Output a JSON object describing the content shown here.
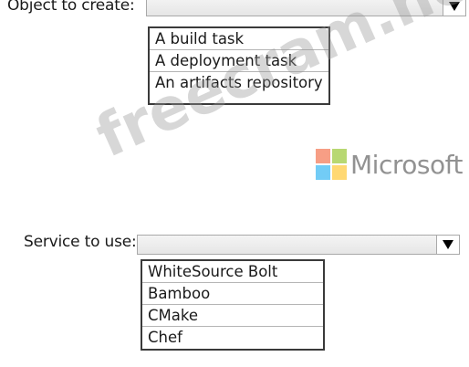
{
  "object_field": {
    "label": "Object to create:",
    "value": "",
    "options": [
      "A build task",
      "A deployment task",
      "An artifacts repository"
    ]
  },
  "service_field": {
    "label": "Service to use:",
    "value": "",
    "options": [
      "WhiteSource Bolt",
      "Bamboo",
      "CMake",
      "Chef"
    ]
  },
  "watermark": {
    "text": "freecram.net",
    "color": "#969696"
  },
  "brand": {
    "text": "Microsoft",
    "colors": [
      "#f25022",
      "#7fba00",
      "#00a4ef",
      "#ffb900"
    ]
  },
  "icons": {
    "dropdown": "triangle-down-icon"
  }
}
